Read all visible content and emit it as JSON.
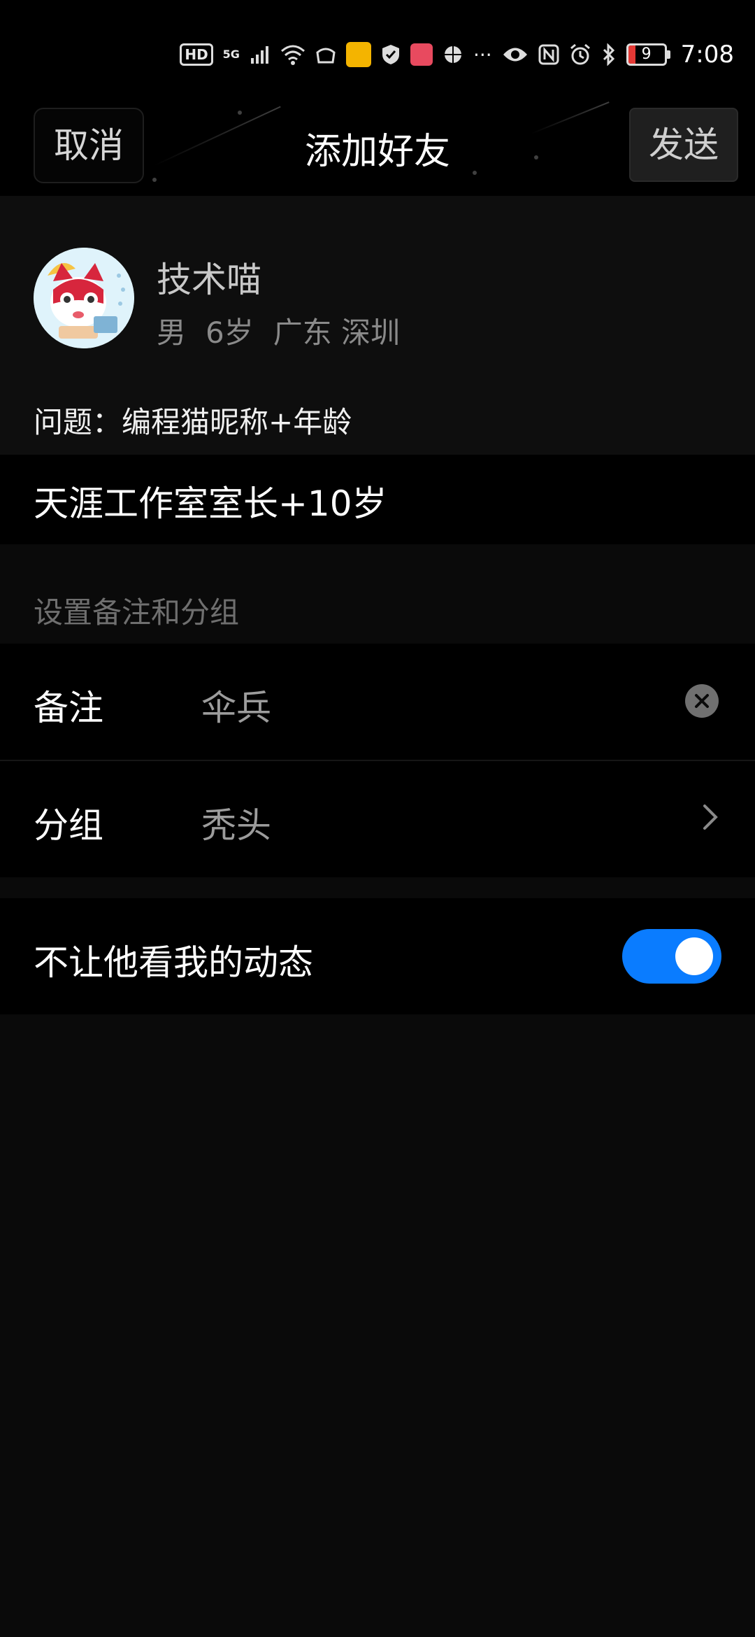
{
  "status_bar": {
    "time": "7:08",
    "battery_level": "9",
    "network_label": "5G",
    "hd_label": "HD",
    "more_label": "···"
  },
  "header": {
    "cancel_label": "取消",
    "title": "添加好友",
    "send_label": "发送"
  },
  "profile": {
    "name": "技术喵",
    "gender": "男",
    "age": "6岁",
    "location": "广东 深圳"
  },
  "verification": {
    "question": "问题：编程猫昵称+年龄",
    "answer": "天涯工作室室长+10岁"
  },
  "settings": {
    "section_label": "设置备注和分组",
    "remark_label": "备注",
    "remark_value": "伞兵",
    "group_label": "分组",
    "group_value": "秃头",
    "hide_moments_label": "不让他看我的动态",
    "hide_moments_enabled": true
  },
  "colors": {
    "toggle_on": "#0a7cff",
    "background": "#0a0a0a"
  }
}
